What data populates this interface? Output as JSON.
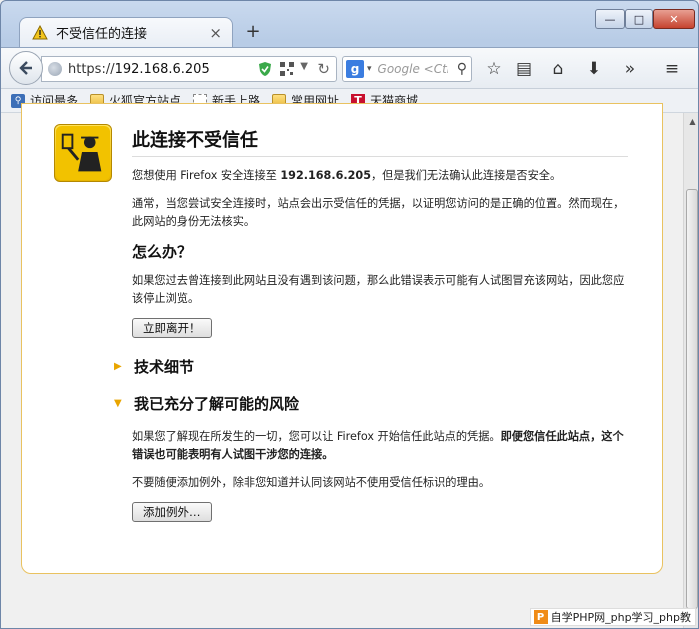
{
  "window": {
    "tab_title": "不受信任的连接",
    "new_tab": "+",
    "close_tab": "×",
    "min": "—",
    "max": "□",
    "close": "✕"
  },
  "navbar": {
    "url_scheme": "https://",
    "url_host": "192.168.6.205",
    "search_engine": "g",
    "search_placeholder": "Google <Ctrl+K>",
    "icons": [
      "back-icon",
      "globe-icon",
      "shield-icon",
      "qr-icon",
      "dropdown-icon",
      "reload-icon",
      "search-icon",
      "bookmark-star-icon",
      "reading-list-icon",
      "home-icon",
      "download-icon",
      "overflow-icon",
      "menu-icon"
    ]
  },
  "bookmarks": [
    {
      "label": "访问最多",
      "icon": "most-visited-icon"
    },
    {
      "label": "火狐官方站点",
      "icon": "folder-icon"
    },
    {
      "label": "新手上路",
      "icon": "page-icon"
    },
    {
      "label": "常用网址",
      "icon": "folder-icon"
    },
    {
      "label": "天猫商城",
      "icon": "tmall-icon"
    }
  ],
  "bm_tmall_letter": "T",
  "page": {
    "title": "此连接不受信任",
    "p1_pre": "您想使用 Firefox 安全连接至 ",
    "p1_host": "192.168.6.205",
    "p1_post": "，但是我们无法确认此连接是否安全。",
    "p2": "通常，当您尝试安全连接时，站点会出示受信任的凭据，以证明您访问的是正确的位置。然而现在，此网站的身份无法核实。",
    "h_what": "怎么办？",
    "p3": "如果您过去曾连接到此网站且没有遇到该问题，那么此错误表示可能有人试图冒充该网站，因此您应该停止浏览。",
    "leave_button": "立即离开！",
    "tech_details": "技术细节",
    "understand_risks": "我已充分了解可能的风险",
    "p4_pre": "如果您了解现在所发生的一切，您可以让 Firefox 开始信任此站点的凭据。",
    "p4_bold": "即便您信任此站点，这个错误也可能表明有人试图干涉您的连接。",
    "p5": "不要随便添加例外，除非您知道并认同该网站不使用受信任标识的理由。",
    "add_exception_button": "添加例外…",
    "collapsed_marker": "▶",
    "expanded_marker": "▼"
  },
  "watermark": {
    "logo": "P",
    "text": "自学PHP网_php学习_php教"
  },
  "colors": {
    "accent": "#e9a500",
    "card_border": "#e9c260",
    "badge": "#f2c200"
  }
}
